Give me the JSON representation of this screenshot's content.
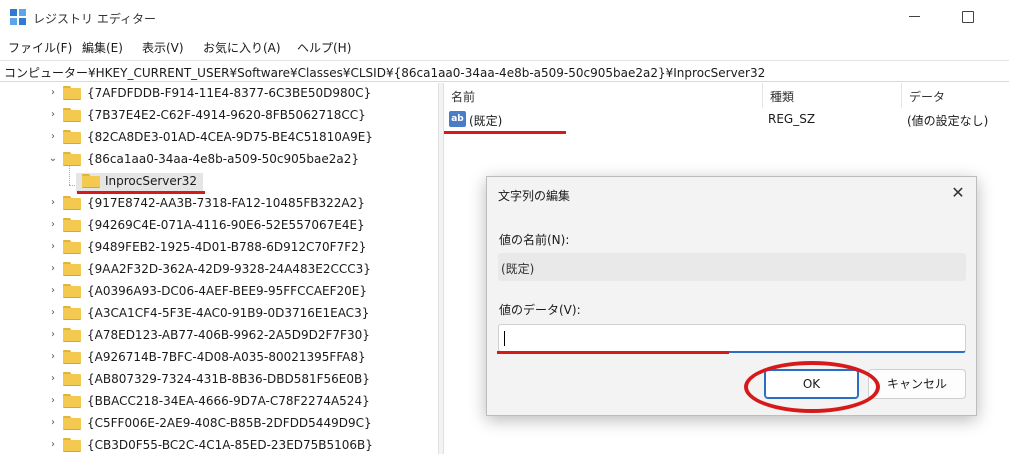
{
  "window": {
    "title": "レジストリ エディター"
  },
  "menu": {
    "items": [
      "ファイル(F)",
      "編集(E)",
      "表示(V)",
      "お気に入り(A)",
      "ヘルプ(H)"
    ]
  },
  "address": {
    "path": "コンピューター¥HKEY_CURRENT_USER¥Software¥Classes¥CLSID¥{86ca1aa0-34aa-4e8b-a509-50c905bae2a2}¥InprocServer32"
  },
  "tree": {
    "items": [
      {
        "label": "{7AFDFDDB-F914-11E4-8377-6C3BE50D980C}",
        "expanded": false,
        "level": 1
      },
      {
        "label": "{7B37E4E2-C62F-4914-9620-8FB5062718CC}",
        "expanded": false,
        "level": 1
      },
      {
        "label": "{82CA8DE3-01AD-4CEA-9D75-BE4C51810A9E}",
        "expanded": false,
        "level": 1
      },
      {
        "label": "{86ca1aa0-34aa-4e8b-a509-50c905bae2a2}",
        "expanded": true,
        "level": 1
      },
      {
        "label": "InprocServer32",
        "expanded": false,
        "level": 2,
        "selected": true
      },
      {
        "label": "{917E8742-AA3B-7318-FA12-10485FB322A2}",
        "expanded": false,
        "level": 1
      },
      {
        "label": "{94269C4E-071A-4116-90E6-52E557067E4E}",
        "expanded": false,
        "level": 1
      },
      {
        "label": "{9489FEB2-1925-4D01-B788-6D912C70F7F2}",
        "expanded": false,
        "level": 1
      },
      {
        "label": "{9AA2F32D-362A-42D9-9328-24A483E2CCC3}",
        "expanded": false,
        "level": 1
      },
      {
        "label": "{A0396A93-DC06-4AEF-BEE9-95FFCCAEF20E}",
        "expanded": false,
        "level": 1
      },
      {
        "label": "{A3CA1CF4-5F3E-4AC0-91B9-0D3716E1EAC3}",
        "expanded": false,
        "level": 1
      },
      {
        "label": "{A78ED123-AB77-406B-9962-2A5D9D2F7F30}",
        "expanded": false,
        "level": 1
      },
      {
        "label": "{A926714B-7BFC-4D08-A035-80021395FFA8}",
        "expanded": false,
        "level": 1
      },
      {
        "label": "{AB807329-7324-431B-8B36-DBD581F56E0B}",
        "expanded": false,
        "level": 1
      },
      {
        "label": "{BBACC218-34EA-4666-9D7A-C78F2274A524}",
        "expanded": false,
        "level": 1
      },
      {
        "label": "{C5FF006E-2AE9-408C-B85B-2DFDD5449D9C}",
        "expanded": false,
        "level": 1
      },
      {
        "label": "{CB3D0F55-BC2C-4C1A-85ED-23ED75B5106B}",
        "expanded": false,
        "level": 1
      }
    ]
  },
  "values_pane": {
    "columns": [
      "名前",
      "種類",
      "データ"
    ],
    "rows": [
      {
        "name": "(既定)",
        "type": "REG_SZ",
        "data": "(値の設定なし)"
      }
    ]
  },
  "dialog": {
    "title": "文字列の編集",
    "close_glyph": "✕",
    "name_label": "値の名前(N):",
    "name_value": "(既定)",
    "data_label": "値のデータ(V):",
    "data_value": "",
    "ok_label": "OK",
    "cancel_label": "キャンセル"
  },
  "colors": {
    "annotation_red": "#d61a1a",
    "accent_blue": "#2b6cc4",
    "folder_yellow": "#f4c94f"
  },
  "icons": {
    "app": "registry-editor-icon",
    "folder": "folder-icon",
    "value": "string-value-ab-icon"
  }
}
